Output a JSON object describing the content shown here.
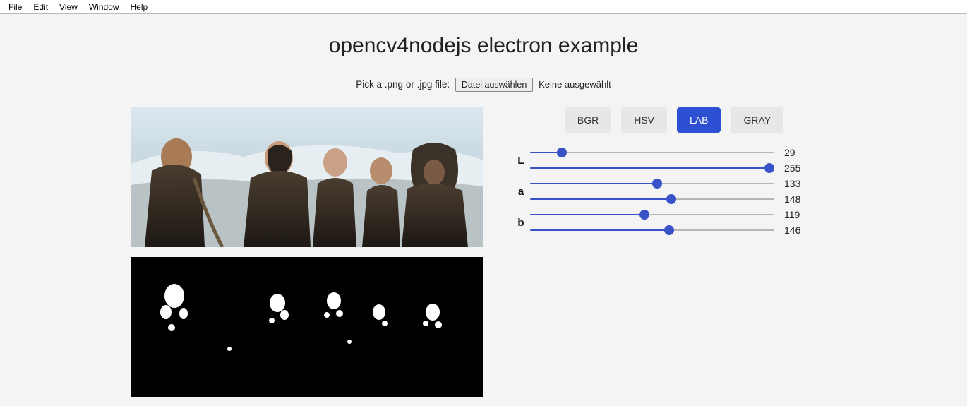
{
  "menubar": [
    "File",
    "Edit",
    "View",
    "Window",
    "Help"
  ],
  "title": "opencv4nodejs electron example",
  "picker": {
    "label": "Pick a .png or .jpg file:",
    "button": "Datei auswählen",
    "status": "Keine ausgewählt"
  },
  "modes": {
    "items": [
      "BGR",
      "HSV",
      "LAB",
      "GRAY"
    ],
    "active": "LAB"
  },
  "sliders": {
    "max": 255,
    "channels": [
      {
        "label": "L",
        "lo": 29,
        "hi": 255
      },
      {
        "label": "a",
        "lo": 133,
        "hi": 148
      },
      {
        "label": "b",
        "lo": 119,
        "hi": 146
      }
    ]
  }
}
